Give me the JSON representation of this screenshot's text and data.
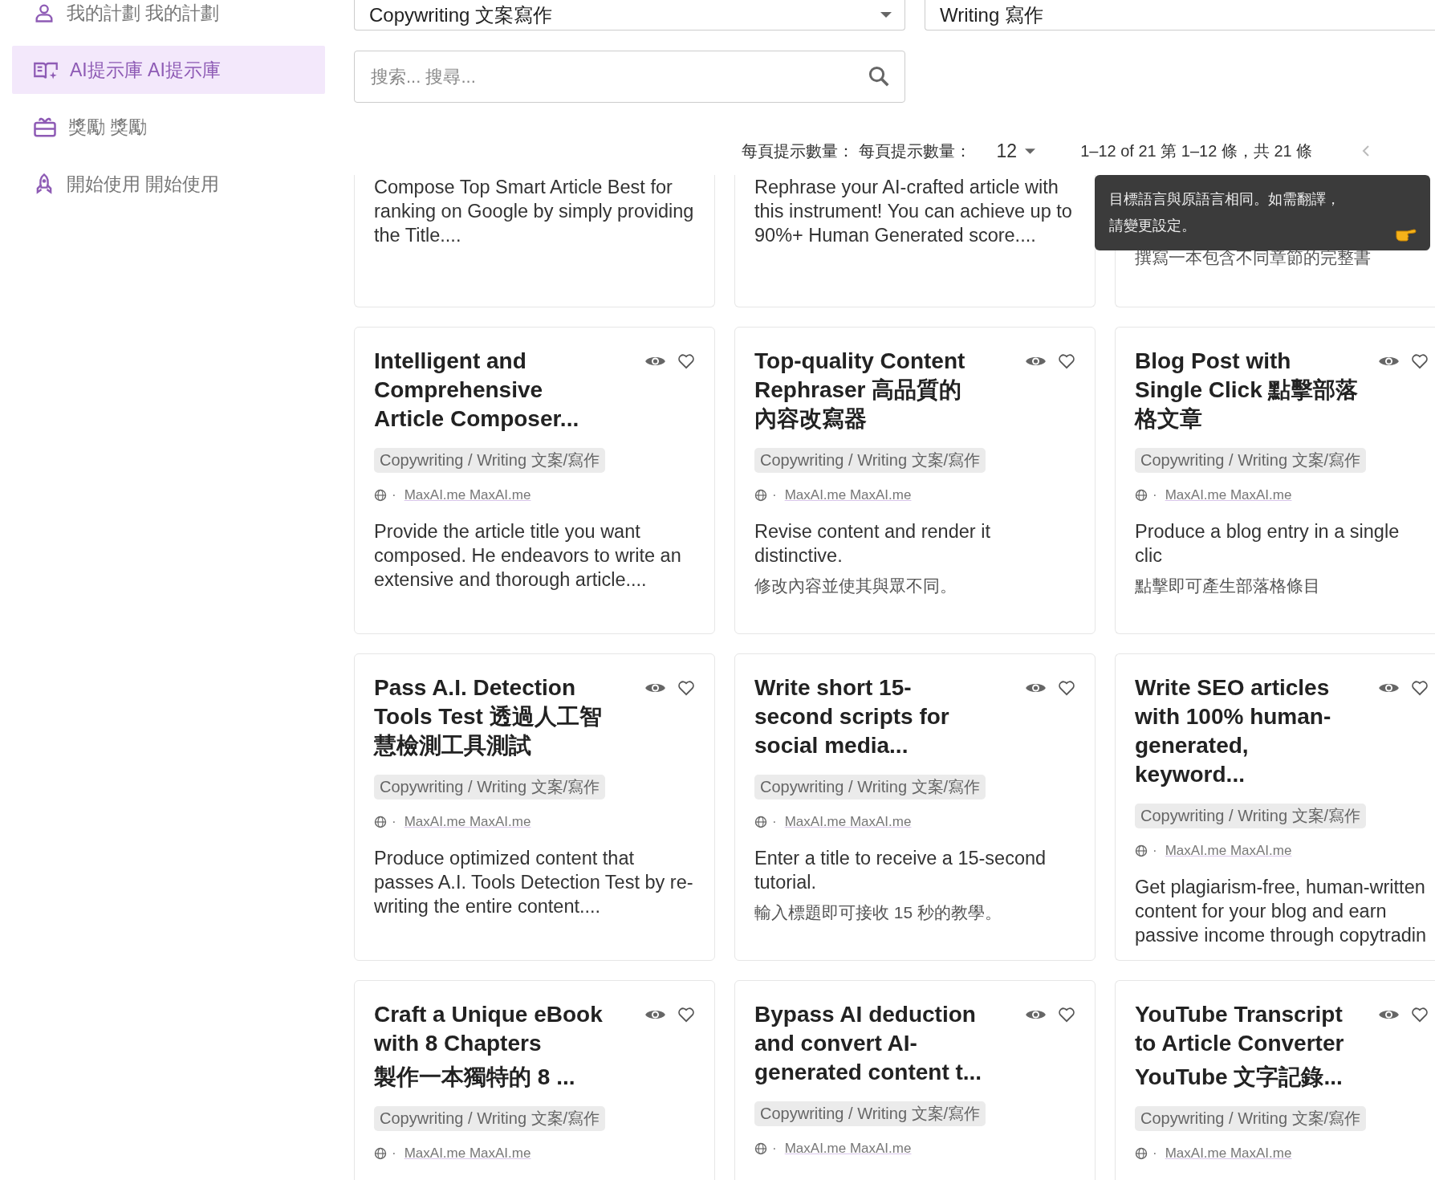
{
  "sidebar": {
    "items": [
      {
        "label": "我的計劃 我的計劃",
        "selected": false
      },
      {
        "label": "AI提示庫 AI提示庫",
        "selected": true
      },
      {
        "label": "獎勵 獎勵",
        "selected": false
      },
      {
        "label": "開始使用 開始使用",
        "selected": false
      }
    ]
  },
  "filters": [
    {
      "value": "Copywriting 文案寫作"
    },
    {
      "value": "Writing 寫作"
    }
  ],
  "separator": "·",
  "search": {
    "placeholder": "搜索... 搜尋..."
  },
  "pagination": {
    "per_page_label": "每頁提示數量： 每頁提示數量：",
    "per_page": "12",
    "range": "1–12 of 21 第 1–12 條，共 21 條"
  },
  "tooltip": {
    "text": "目標語言與原語言相同。如需翻譯，請變更設定。"
  },
  "cards": [
    {
      "kind": "partial",
      "description": "Compose Top Smart Article Best for ranking on Google by simply providing the Title...."
    },
    {
      "kind": "partial",
      "description": "Rephrase your AI-crafted article with this instrument! You can achieve up to 90%+ Human Generated score...."
    },
    {
      "kind": "partial",
      "description_zh": "撰寫一本包含不同章節的完整書"
    },
    {
      "kind": "full",
      "title": "Intelligent and Comprehensive Article Composer...",
      "tag": "Copywriting / Writing 文案/寫作",
      "site": "MaxAI.me MaxAI.me",
      "description": "Provide the article title you want composed. He endeavors to write an extensive and thorough article...."
    },
    {
      "kind": "full",
      "title": "Top-quality Content Rephraser 高品質的內容改寫器",
      "tag": "Copywriting / Writing 文案/寫作",
      "site": "MaxAI.me MaxAI.me",
      "description": "Revise content and render it distinctive.",
      "description_zh": "修改內容並使其與眾不同。"
    },
    {
      "kind": "full",
      "title": "Blog Post with Single Click 點擊部落格文章",
      "tag": "Copywriting / Writing 文案/寫作",
      "site": "MaxAI.me MaxAI.me",
      "description": "Produce a blog entry in a single clic",
      "description_zh": "點擊即可產生部落格條目"
    },
    {
      "kind": "full",
      "title": "Pass A.I. Detection Tools Test 透過人工智慧檢測工具測試",
      "tag": "Copywriting / Writing 文案/寫作",
      "site": "MaxAI.me MaxAI.me",
      "description": "Produce optimized content that passes A.I. Tools Detection Test by re-writing the entire content...."
    },
    {
      "kind": "full",
      "title": "Write short 15-second scripts for social media...",
      "tag": "Copywriting / Writing 文案/寫作",
      "site": "MaxAI.me MaxAI.me",
      "description": "Enter a title to receive a 15-second tutorial.",
      "description_zh": "輸入標題即可接收 15 秒的教學。"
    },
    {
      "kind": "full",
      "title": "Write SEO articles with 100% human-generated, keyword...",
      "tag": "Copywriting / Writing 文案/寫作",
      "site": "MaxAI.me MaxAI.me",
      "description": "Get plagiarism-free, human-written content for your blog and earn passive income through copytradin"
    },
    {
      "kind": "full",
      "title": "Craft a Unique eBook with 8 Chapters",
      "title_zh": "製作一本獨特的 8 ...",
      "tag": "Copywriting / Writing 文案/寫作",
      "site": "MaxAI.me MaxAI.me"
    },
    {
      "kind": "full",
      "title": "Bypass AI deduction and convert AI-generated content t...",
      "tag": "Copywriting / Writing 文案/寫作",
      "site": "MaxAI.me MaxAI.me"
    },
    {
      "kind": "full",
      "title": "YouTube Transcript to Article Converter",
      "title_zh": "YouTube 文字記錄...",
      "tag": "Copywriting / Writing 文案/寫作",
      "site": "MaxAI.me MaxAI.me"
    }
  ]
}
